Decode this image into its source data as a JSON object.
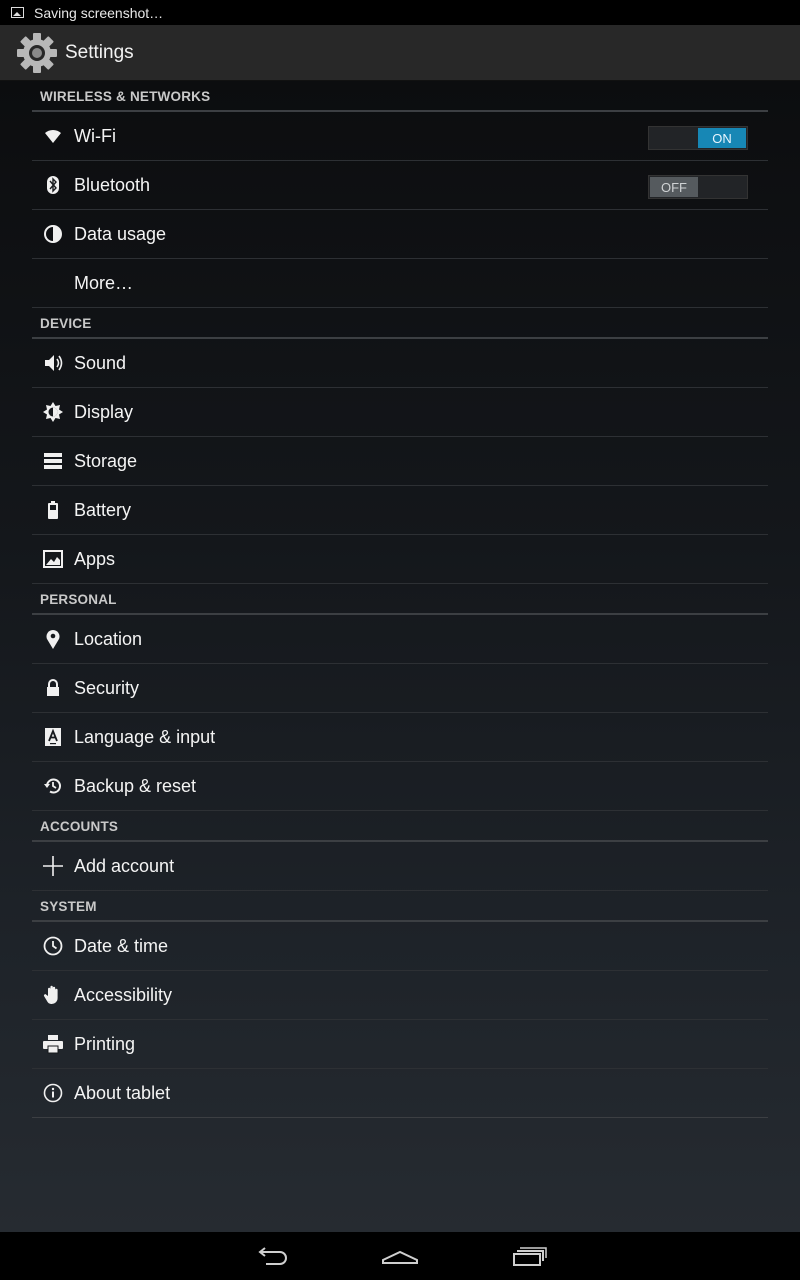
{
  "status_bar": {
    "notification_icon": "image-icon",
    "text": "Saving screenshot…"
  },
  "action_bar": {
    "icon": "gear-icon",
    "title": "Settings"
  },
  "sections": {
    "wireless": {
      "header": "WIRELESS & NETWORKS",
      "wifi": {
        "label": "Wi-Fi",
        "icon": "wifi-icon",
        "toggle": "ON"
      },
      "bluetooth": {
        "label": "Bluetooth",
        "icon": "bluetooth-icon",
        "toggle": "OFF"
      },
      "data_usage": {
        "label": "Data usage",
        "icon": "data-usage-icon"
      },
      "more": {
        "label": "More…"
      }
    },
    "device": {
      "header": "DEVICE",
      "sound": {
        "label": "Sound",
        "icon": "speaker-icon"
      },
      "display": {
        "label": "Display",
        "icon": "brightness-icon"
      },
      "storage": {
        "label": "Storage",
        "icon": "storage-icon"
      },
      "battery": {
        "label": "Battery",
        "icon": "battery-icon"
      },
      "apps": {
        "label": "Apps",
        "icon": "apps-icon"
      }
    },
    "personal": {
      "header": "PERSONAL",
      "location": {
        "label": "Location",
        "icon": "location-pin-icon"
      },
      "security": {
        "label": "Security",
        "icon": "lock-icon"
      },
      "language": {
        "label": "Language & input",
        "icon": "language-icon"
      },
      "backup": {
        "label": "Backup & reset",
        "icon": "backup-icon"
      }
    },
    "accounts": {
      "header": "ACCOUNTS",
      "add_account": {
        "label": "Add account",
        "icon": "plus-icon"
      }
    },
    "system": {
      "header": "SYSTEM",
      "date_time": {
        "label": "Date & time",
        "icon": "clock-icon"
      },
      "accessibility": {
        "label": "Accessibility",
        "icon": "hand-icon"
      },
      "printing": {
        "label": "Printing",
        "icon": "printer-icon"
      },
      "about": {
        "label": "About tablet",
        "icon": "info-icon"
      }
    }
  },
  "nav_bar": {
    "back": "back-icon",
    "home": "home-icon",
    "recents": "recents-icon"
  },
  "colors": {
    "accent": "#1787b5",
    "action_bar": "#282828",
    "divider": "#3c3f43"
  }
}
